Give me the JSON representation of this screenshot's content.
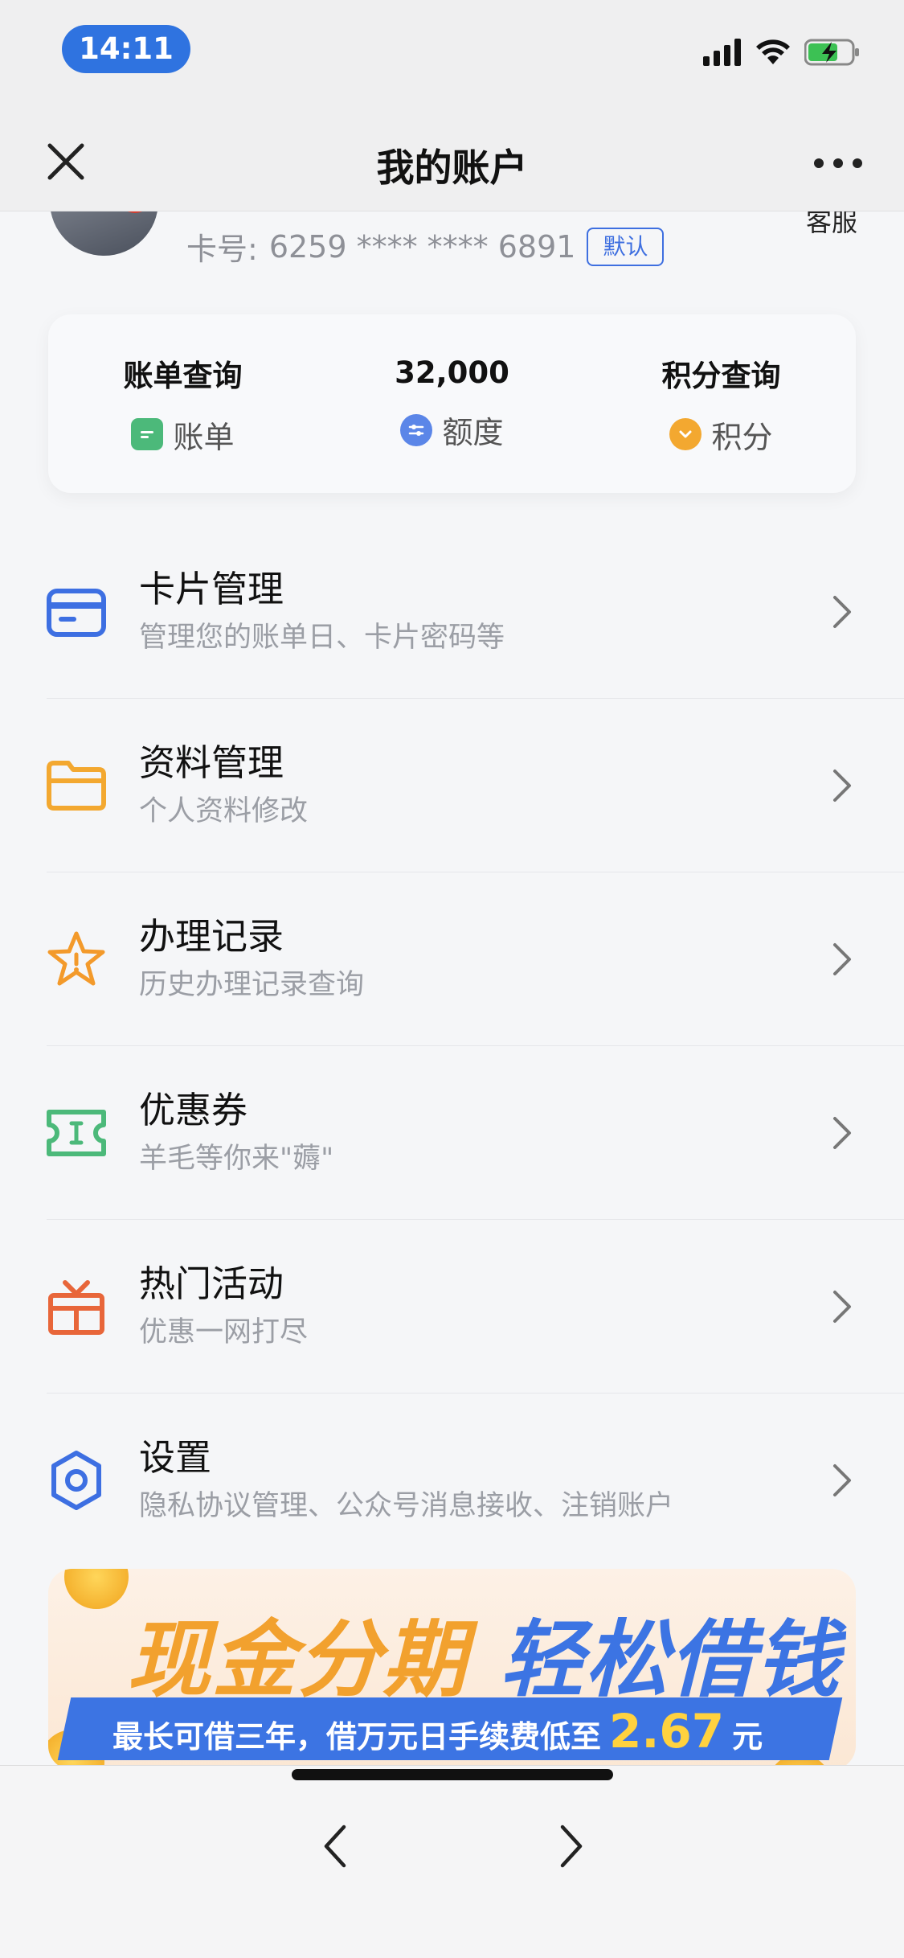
{
  "status_bar": {
    "time": "14:11"
  },
  "nav": {
    "title": "我的账户"
  },
  "account": {
    "card_label": "卡号:",
    "card_number": "6259 **** **** 6891",
    "default_tag": "默认",
    "service_label": "客服"
  },
  "summary": [
    {
      "title": "账单查询",
      "sub_label": "账单",
      "icon": "bill-icon",
      "color": "#4cb97a"
    },
    {
      "title": "32,000",
      "sub_label": "额度",
      "icon": "limit-icon",
      "color": "#5b86e8"
    },
    {
      "title": "积分查询",
      "sub_label": "积分",
      "icon": "points-icon",
      "color": "#f3a830"
    }
  ],
  "menu": [
    {
      "title": "卡片管理",
      "desc": "管理您的账单日、卡片密码等",
      "icon": "card-icon",
      "color": "#3d6fe2"
    },
    {
      "title": "资料管理",
      "desc": "个人资料修改",
      "icon": "folder-icon",
      "color": "#f3a830"
    },
    {
      "title": "办理记录",
      "desc": "历史办理记录查询",
      "icon": "star-icon",
      "color": "#f39a2b"
    },
    {
      "title": "优惠券",
      "desc": "羊毛等你来\"薅\"",
      "icon": "coupon-icon",
      "color": "#4cb97a"
    },
    {
      "title": "热门活动",
      "desc": "优惠一网打尽",
      "icon": "gift-icon",
      "color": "#e8663a"
    },
    {
      "title": "设置",
      "desc": "隐私协议管理、公众号消息接收、注销账户",
      "icon": "gear-icon",
      "color": "#3d6fe2"
    }
  ],
  "banner": {
    "headline_left": "现金分期",
    "headline_right": "轻松借钱",
    "subline": "最长可借三年，借万元日手续费低至",
    "rate": "2.67",
    "unit": "元"
  }
}
